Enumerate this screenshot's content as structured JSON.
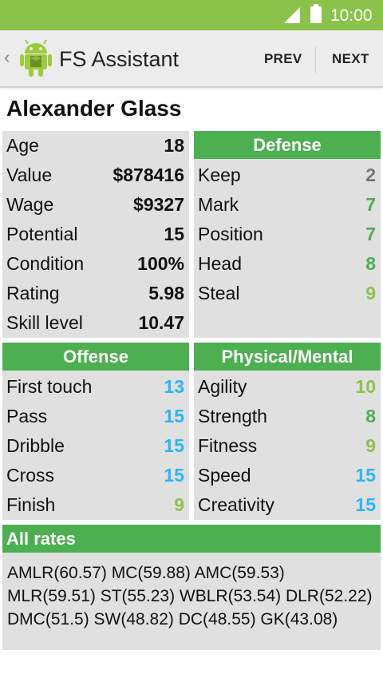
{
  "status": {
    "time": "10:00"
  },
  "toolbar": {
    "title": "FS Assistant",
    "prev_label": "PREV",
    "next_label": "NEXT"
  },
  "player": {
    "name": "Alexander Glass",
    "info": [
      {
        "label": "Age",
        "value": "18"
      },
      {
        "label": "Value",
        "value": "$878416"
      },
      {
        "label": "Wage",
        "value": "$9327"
      },
      {
        "label": "Potential",
        "value": "15"
      },
      {
        "label": "Condition",
        "value": "100%"
      },
      {
        "label": "Rating",
        "value": "5.98"
      },
      {
        "label": "Skill level",
        "value": "10.47"
      }
    ]
  },
  "defense": {
    "title": "Defense",
    "items": [
      {
        "label": "Keep",
        "value": "2"
      },
      {
        "label": "Mark",
        "value": "7"
      },
      {
        "label": "Position",
        "value": "7"
      },
      {
        "label": "Head",
        "value": "8"
      },
      {
        "label": "Steal",
        "value": "9"
      }
    ]
  },
  "offense": {
    "title": "Offense",
    "items": [
      {
        "label": "First touch",
        "value": "13"
      },
      {
        "label": "Pass",
        "value": "15"
      },
      {
        "label": "Dribble",
        "value": "15"
      },
      {
        "label": "Cross",
        "value": "15"
      },
      {
        "label": "Finish",
        "value": "9"
      }
    ]
  },
  "physical": {
    "title": "Physical/Mental",
    "items": [
      {
        "label": "Agility",
        "value": "10"
      },
      {
        "label": "Strength",
        "value": "8"
      },
      {
        "label": "Fitness",
        "value": "9"
      },
      {
        "label": "Speed",
        "value": "15"
      },
      {
        "label": "Creativity",
        "value": "15"
      }
    ]
  },
  "rates": {
    "title": "All rates",
    "text": "AMLR(60.57) MC(59.88) AMC(59.53) MLR(59.51) ST(55.23) WBLR(53.54) DLR(52.22) DMC(51.5) SW(48.82) DC(48.55) GK(43.08)"
  },
  "colors": {
    "statusbar": "#8bc34a",
    "header_green": "#4caf50",
    "panel_bg": "#e0e0e0",
    "value_grey": "#757575",
    "value_green": "#4caf50",
    "value_lightgreen": "#8bc34a",
    "value_blue": "#29b6f6"
  }
}
